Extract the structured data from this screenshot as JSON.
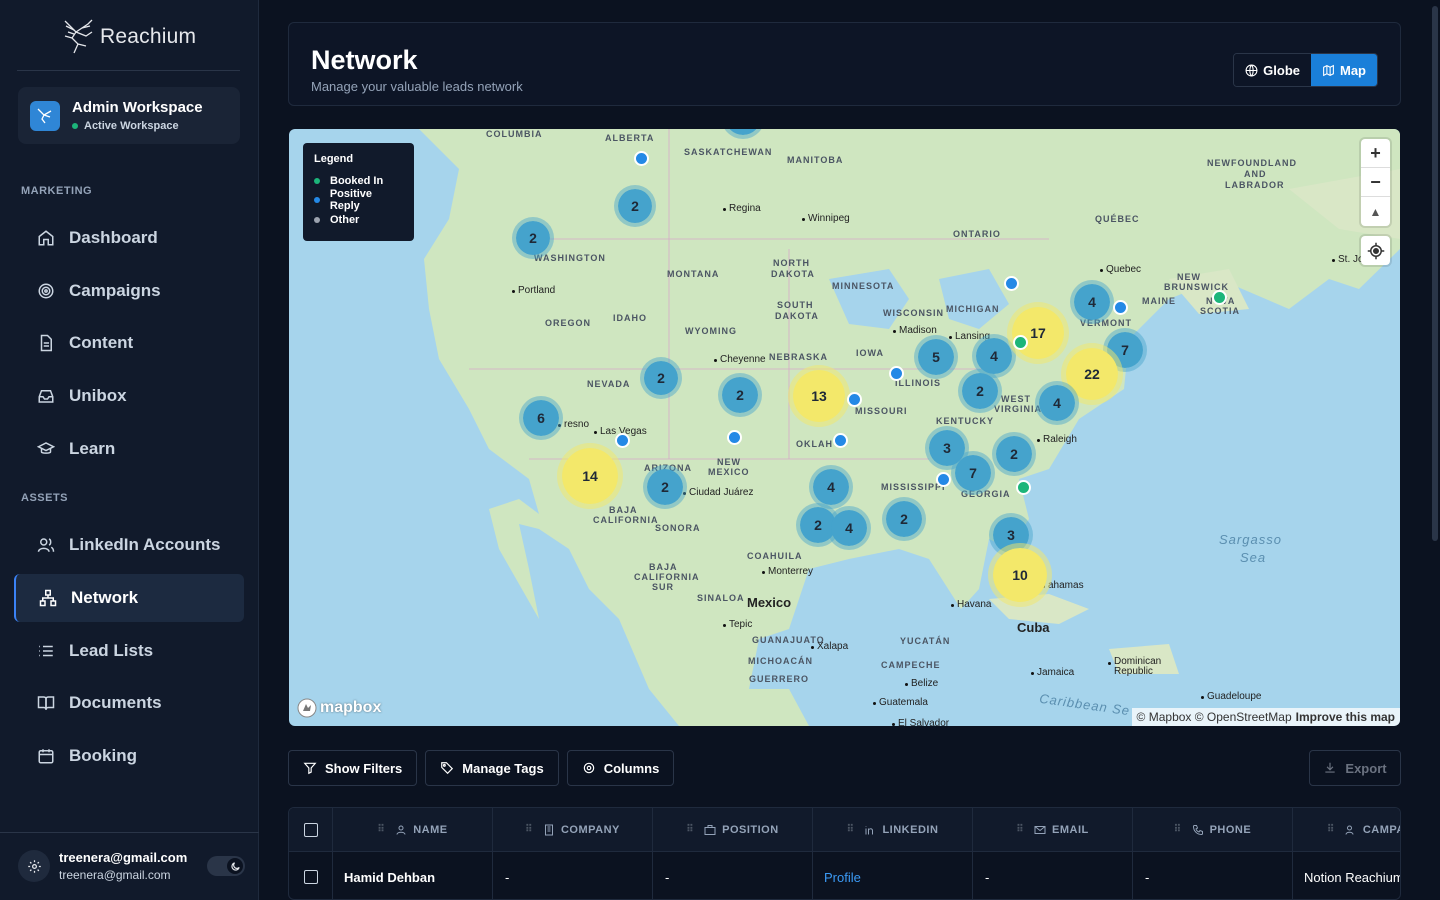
{
  "app": {
    "name": "Reachium"
  },
  "workspace": {
    "title": "Admin Workspace",
    "status": "Active Workspace"
  },
  "sidebar": {
    "sections": [
      {
        "label": "MARKETING",
        "items": [
          {
            "label": "Dashboard",
            "icon": "home-icon"
          },
          {
            "label": "Campaigns",
            "icon": "target-icon"
          },
          {
            "label": "Content",
            "icon": "document-icon"
          },
          {
            "label": "Unibox",
            "icon": "inbox-icon"
          },
          {
            "label": "Learn",
            "icon": "graduation-cap-icon"
          }
        ]
      },
      {
        "label": "ASSETS",
        "items": [
          {
            "label": "LinkedIn Accounts",
            "icon": "users-icon"
          },
          {
            "label": "Network",
            "icon": "network-icon",
            "active": true
          },
          {
            "label": "Lead Lists",
            "icon": "list-icon"
          },
          {
            "label": "Documents",
            "icon": "book-icon"
          },
          {
            "label": "Booking",
            "icon": "calendar-icon"
          }
        ]
      }
    ]
  },
  "user": {
    "name": "treenera@gmail.com",
    "email": "treenera@gmail.com"
  },
  "header": {
    "title": "Network",
    "subtitle": "Manage your valuable leads network"
  },
  "view_switch": {
    "globe": "Globe",
    "map": "Map",
    "active": "Map"
  },
  "legend": {
    "title": "Legend",
    "items": [
      {
        "label": "Booked In",
        "color": "#1cb57a"
      },
      {
        "label": "Positive Reply",
        "color": "#2489e6"
      },
      {
        "label": "Other",
        "color": "#9ca3af"
      }
    ]
  },
  "map": {
    "attribution": "© Mapbox © OpenStreetMap",
    "improve": "Improve this map",
    "logo": "mapbox",
    "region_labels": [
      "COLUMBIA",
      "ALBERTA",
      "SASKATCHEWAN",
      "MANITOBA",
      "ONTARIO",
      "QUÉBEC",
      "NEWFOUNDLAND",
      "AND",
      "LABRADOR",
      "WASHINGTON",
      "MONTANA",
      "NORTH",
      "DAKOTA",
      "MINNESOTA",
      "SOUTH",
      "DAKOTA",
      "OREGON",
      "IDAHO",
      "WYOMING",
      "WISCONSIN",
      "MICHIGAN",
      "NEBRASKA",
      "IOWA",
      "NEVADA",
      "ILLINOIS",
      "MISSOURI",
      "KENTUCKY",
      "WEST",
      "VIRGINIA",
      "OKLAH",
      "NEW",
      "MEXICO",
      "ARIZONA",
      "MISSISSIPPI",
      "GEORGIA",
      "BAJA",
      "CALIFORNIA",
      "SONORA",
      "COAHUILA",
      "BAJA",
      "CALIFORNIA",
      "SUR",
      "SINALOA",
      "GUANAJUATO",
      "MICHOACÁN",
      "GUERRERO",
      "YUCATÁN",
      "CAMPECHE",
      "NEW",
      "BRUNSWICK",
      "MAINE",
      "VERMONT",
      "NOVA",
      "SCOTIA"
    ],
    "cities": [
      "Regina",
      "Winnipeg",
      "Portland",
      "Cheyenne",
      "Madison",
      "Lansing",
      "Las Vegas",
      "resno",
      "Ciudad Juárez",
      "Monterrey",
      "Tepic",
      "Xalapa",
      "Raleigh",
      "Quebec",
      "St. Jo",
      "Havana",
      "ahamas",
      "Jamaica",
      "Dominican Republic",
      "Guadeloupe",
      "Belize",
      "Guatemala",
      "El Salvador"
    ],
    "countries": [
      "Mexico",
      "Cuba"
    ],
    "seas": [
      "Sargasso",
      "Sea",
      "Caribbean Se"
    ],
    "clusters": [
      {
        "count": "2",
        "color": "blue"
      },
      {
        "count": "2",
        "color": "blue"
      },
      {
        "count": "2",
        "color": "blue"
      },
      {
        "count": "2",
        "color": "blue"
      },
      {
        "count": "6",
        "color": "blue"
      },
      {
        "count": "14",
        "color": "yellow"
      },
      {
        "count": "2",
        "color": "blue"
      },
      {
        "count": "13",
        "color": "yellow"
      },
      {
        "count": "4",
        "color": "blue"
      },
      {
        "count": "2",
        "color": "blue"
      },
      {
        "count": "4",
        "color": "blue"
      },
      {
        "count": "2",
        "color": "blue"
      },
      {
        "count": "5",
        "color": "blue"
      },
      {
        "count": "4",
        "color": "blue"
      },
      {
        "count": "17",
        "color": "yellow"
      },
      {
        "count": "4",
        "color": "blue"
      },
      {
        "count": "7",
        "color": "blue"
      },
      {
        "count": "22",
        "color": "yellow"
      },
      {
        "count": "2",
        "color": "blue"
      },
      {
        "count": "4",
        "color": "blue"
      },
      {
        "count": "3",
        "color": "blue"
      },
      {
        "count": "7",
        "color": "blue"
      },
      {
        "count": "2",
        "color": "blue"
      },
      {
        "count": "3",
        "color": "blue"
      },
      {
        "count": "10",
        "color": "yellow"
      }
    ]
  },
  "toolbar": {
    "show_filters": "Show Filters",
    "manage_tags": "Manage Tags",
    "columns": "Columns",
    "export": "Export"
  },
  "table": {
    "columns": [
      "NAME",
      "COMPANY",
      "POSITION",
      "LINKEDIN",
      "EMAIL",
      "PHONE",
      "CAMPA"
    ],
    "rows": [
      {
        "name": "Hamid Dehban",
        "company": "-",
        "position": "-",
        "linkedin": "Profile",
        "email": "-",
        "phone": "-",
        "campaign": "Notion Reachium"
      }
    ]
  }
}
